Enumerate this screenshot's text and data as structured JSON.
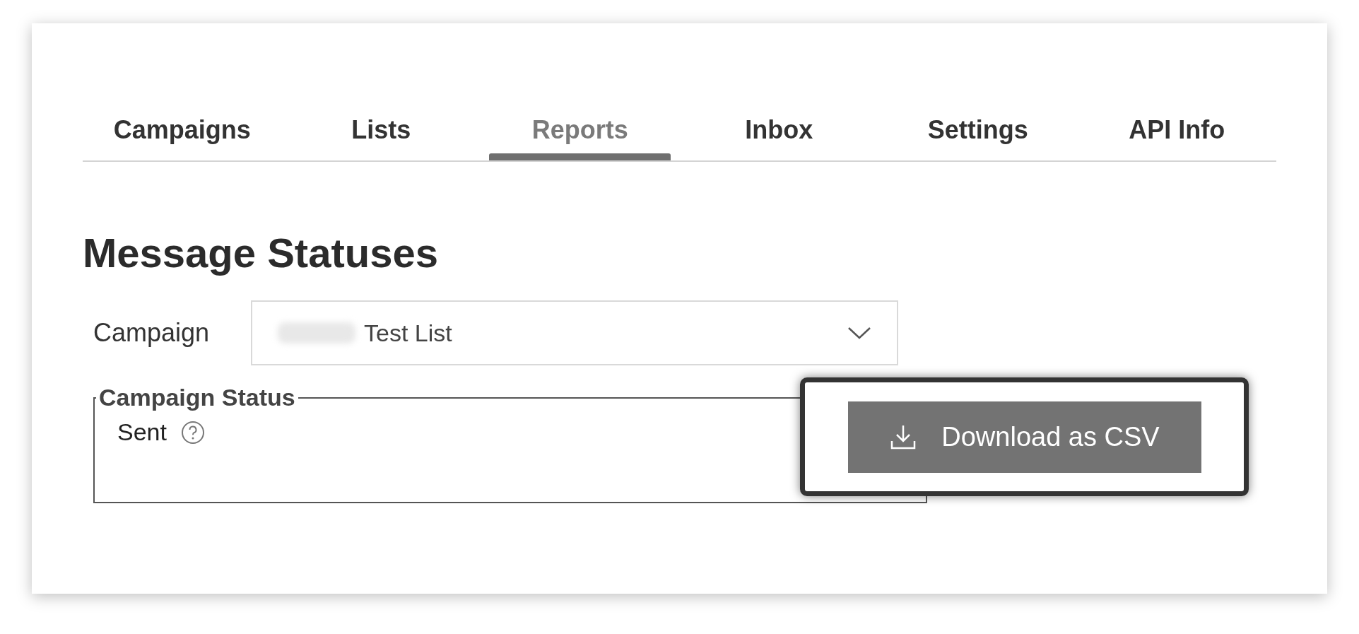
{
  "tabs": [
    {
      "label": "Campaigns",
      "selected": false
    },
    {
      "label": "Lists",
      "selected": false
    },
    {
      "label": "Reports",
      "selected": true
    },
    {
      "label": "Inbox",
      "selected": false
    },
    {
      "label": "Settings",
      "selected": false
    },
    {
      "label": "API Info",
      "selected": false
    }
  ],
  "heading": "Message Statuses",
  "campaign_field": {
    "label": "Campaign",
    "value": "Test List"
  },
  "campaign_status": {
    "legend": "Campaign Status",
    "status": "Sent"
  },
  "download_button": {
    "label": "Download as CSV"
  }
}
